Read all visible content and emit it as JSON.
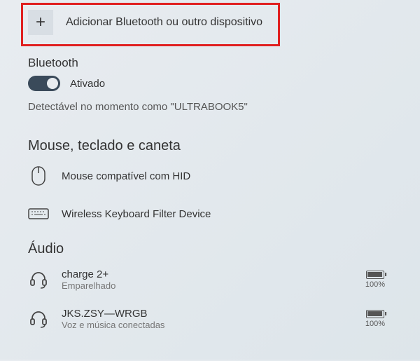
{
  "addDevice": {
    "label": "Adicionar Bluetooth ou outro dispositivo",
    "plus": "+"
  },
  "bluetooth": {
    "title": "Bluetooth",
    "toggleState": "Ativado",
    "discoverable": "Detectável no momento como \"ULTRABOOK5\""
  },
  "sections": {
    "mouse": {
      "title": "Mouse, teclado e caneta",
      "devices": [
        {
          "name": "Mouse compatível com HID",
          "icon": "mouse"
        },
        {
          "name": "Wireless Keyboard Filter Device",
          "icon": "keyboard"
        }
      ]
    },
    "audio": {
      "title": "Áudio",
      "devices": [
        {
          "name": "charge 2+",
          "status": "Emparelhado",
          "battery": "100%",
          "icon": "headset"
        },
        {
          "name": "JKS.ZSY—WRGB",
          "status": "Voz e música conectadas",
          "battery": "100%",
          "icon": "headset"
        }
      ]
    }
  }
}
